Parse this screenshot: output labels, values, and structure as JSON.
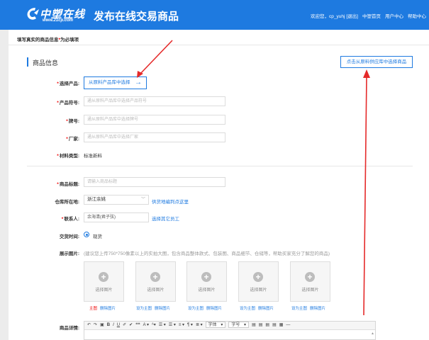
{
  "header": {
    "logo_cn": "中塑在线",
    "logo_url": "www.21cp.com",
    "title": "发布在线交易商品",
    "nav": [
      "欢迎您，cp_yuhj",
      "[退出]",
      "中塑首页",
      "用户中心",
      "帮助中心"
    ]
  },
  "notice": {
    "text": "填写真实的商品信息",
    "required_mark": "*",
    "suffix": "为必填项"
  },
  "section": {
    "title": "商品信息",
    "select_from_lib_button": "点击从原料供应库中选择商品"
  },
  "form": {
    "product": {
      "label": "选择产品:",
      "button": "从原料产品库中选择",
      "arrow": "→"
    },
    "product_code": {
      "label": "产品符号:",
      "placeholder": "通从原料产品库中选择产品符号"
    },
    "brand": {
      "label": "牌号:",
      "placeholder": "通从原料产品库中选择牌号"
    },
    "maker": {
      "label": "厂家:",
      "placeholder": "通从原料产品库中选择厂家"
    },
    "material_type": {
      "label": "材料类型:",
      "value": "标准新料"
    },
    "goods_title": {
      "label": "商品标题:",
      "placeholder": "请输入商品标题"
    },
    "warehouse": {
      "label": "仓库所在地:",
      "value": "浙江余姚",
      "link": "供货地编判点这里"
    },
    "contact": {
      "label": "联系人:",
      "value": "余海清(君子弦)",
      "link": "选择其它员工"
    },
    "trade_time": {
      "label": "交货时间:",
      "option": "现货"
    },
    "images": {
      "label": "展示图片:",
      "hint": "(建议您上传750*750像素以上的实拍大图，包含商品整体款式、包装图、商品细节、仓储等，帮助买家充分了解您的商品)",
      "upload_text": "选择图片",
      "main_label": "主图",
      "delete_label": "删除图片",
      "set_main_label": "设为主图"
    },
    "details": {
      "label": "商品详情:",
      "toolbar": [
        "↶",
        "↷",
        "▣",
        "B",
        "I",
        "U",
        "✐",
        "✔",
        "❝❝",
        "A ▾",
        "ᴬ▾",
        "☰ ▾",
        "☰ ▾",
        "≡ ▾",
        "¶ ▾",
        "≣ ▾"
      ],
      "font_family": "字体",
      "font_size": "字号",
      "align": [
        "▤",
        "▤",
        "▤",
        "▤",
        "▦",
        "—"
      ]
    }
  }
}
